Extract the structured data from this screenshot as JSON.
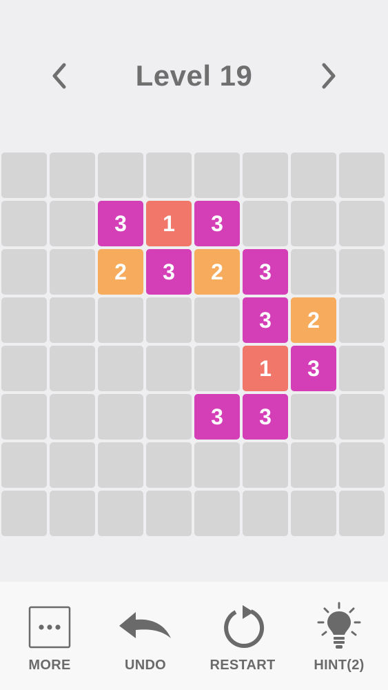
{
  "header": {
    "title": "Level 19",
    "prev_icon": "chevron-left-icon",
    "next_icon": "chevron-right-icon"
  },
  "colors": {
    "background": "#efeef0",
    "empty_cell": "#d5d5d5",
    "tile_3": "#d43fb8",
    "tile_2": "#f7ab5c",
    "tile_1": "#f0776a",
    "text": "#6f6f6f"
  },
  "board": {
    "rows": 8,
    "cols": 8,
    "tiles": [
      {
        "row": 1,
        "col": 2,
        "value": "3"
      },
      {
        "row": 1,
        "col": 3,
        "value": "1"
      },
      {
        "row": 1,
        "col": 4,
        "value": "3"
      },
      {
        "row": 2,
        "col": 2,
        "value": "2"
      },
      {
        "row": 2,
        "col": 3,
        "value": "3"
      },
      {
        "row": 2,
        "col": 4,
        "value": "2"
      },
      {
        "row": 2,
        "col": 5,
        "value": "3"
      },
      {
        "row": 3,
        "col": 5,
        "value": "3"
      },
      {
        "row": 3,
        "col": 6,
        "value": "2"
      },
      {
        "row": 4,
        "col": 5,
        "value": "1"
      },
      {
        "row": 4,
        "col": 6,
        "value": "3"
      },
      {
        "row": 5,
        "col": 4,
        "value": "3"
      },
      {
        "row": 5,
        "col": 5,
        "value": "3"
      }
    ]
  },
  "toolbar": {
    "more_label": "MORE",
    "undo_label": "UNDO",
    "restart_label": "RESTART",
    "hint_label": "HINT(2)",
    "more_icon": "more-dots-icon",
    "undo_icon": "undo-arrow-icon",
    "restart_icon": "restart-icon",
    "hint_icon": "lightbulb-icon"
  }
}
